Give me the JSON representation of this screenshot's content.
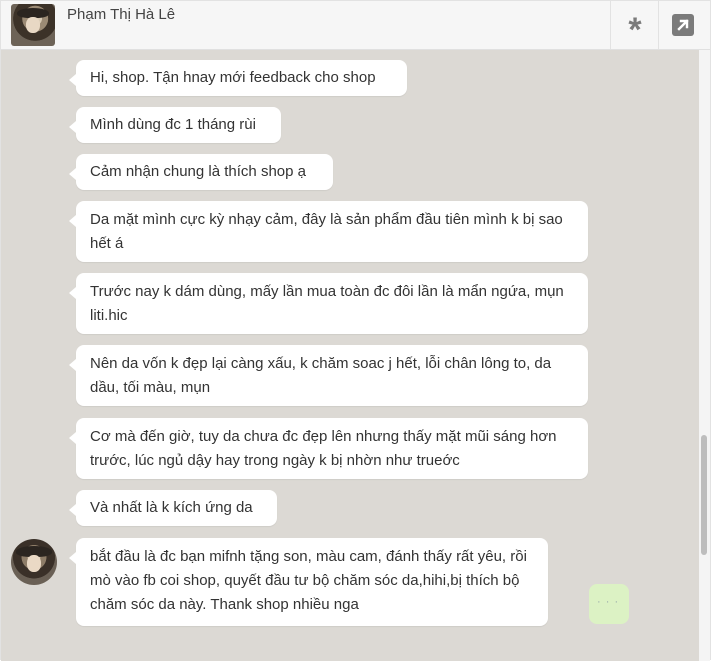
{
  "header": {
    "contact_name": "Phạm Thị Hà Lê",
    "settings_icon": "asterisk-icon",
    "expand_icon": "expand-icon"
  },
  "messages": [
    {
      "text": "Hi, shop. Tận hnay mới feedback cho shop"
    },
    {
      "text": "Mình dùng đc 1 tháng rùi"
    },
    {
      "text": "Cảm nhận chung là thích shop ạ"
    },
    {
      "text": "Da mặt mình cực kỳ nhạy cảm, đây là sản phẩm đầu tiên mình k bị sao hết á"
    },
    {
      "text": "Trước nay k dám dùng, mấy lần mua toàn đc đôi lần là mẩn ngứa, mụn liti.hic"
    },
    {
      "text": "Nên da vốn k đẹp lại càng xấu, k chăm soac j hết, lỗi chân lông to, da dầu, tối màu, mụn"
    },
    {
      "text": "Cơ mà đến giờ, tuy da chưa đc đẹp lên nhưng thấy mặt mũi sáng hơn trước, lúc ngủ dậy hay trong ngày k bị nhờn như trueớc"
    },
    {
      "text": "Và nhất là k kích ứng da"
    },
    {
      "text": "bắt đầu là đc bạn mifnh tặng son, màu cam, đánh thấy rất yêu, rồi mò vào fb coi shop, quyết đầu tư bộ chăm sóc da,hihi,bị thích bộ chăm sóc da này. Thank shop nhiều nga"
    }
  ],
  "own_message_partial": "· · ·"
}
